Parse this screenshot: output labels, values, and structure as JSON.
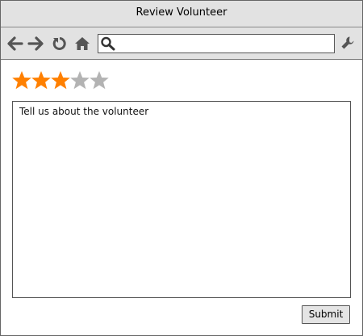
{
  "window": {
    "title": "Review Volunteer"
  },
  "toolbar": {
    "icons": [
      "back-arrow-icon",
      "forward-arrow-icon",
      "refresh-icon",
      "home-icon",
      "search-icon",
      "wrench-icon"
    ],
    "url_value": ""
  },
  "rating": {
    "value": 3,
    "max": 5,
    "filled_color": "#ff8000",
    "empty_color": "#b3b3b3"
  },
  "review": {
    "text": "Tell us about the volunteer"
  },
  "actions": {
    "submit_label": "Submit"
  }
}
